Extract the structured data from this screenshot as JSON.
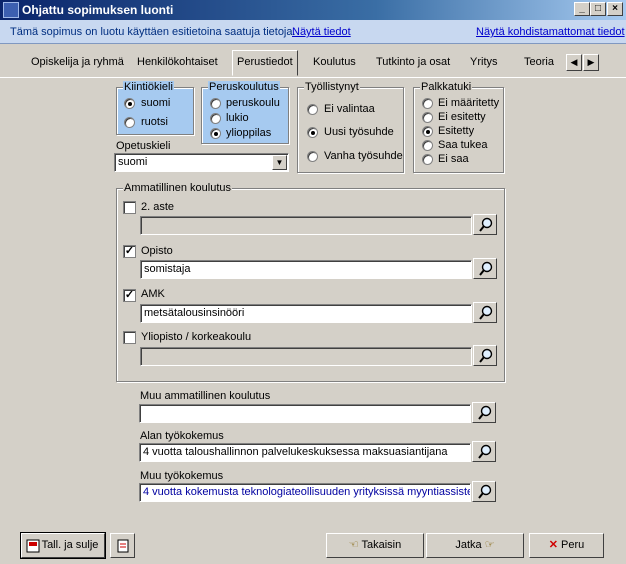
{
  "window": {
    "title": "Ohjattu sopimuksen luonti"
  },
  "info": {
    "message": "Tämä sopimus on luotu käyttäen esitietoina saatuja tietoja.",
    "show_info_link": "Näytä tiedot",
    "show_unassigned_link": "Näytä kohdistamattomat tiedot"
  },
  "tabs": [
    {
      "label": "Opiskelija ja ryhmä"
    },
    {
      "label": "Henkilökohtaiset"
    },
    {
      "label": "Perustiedot"
    },
    {
      "label": "Koulutus"
    },
    {
      "label": "Tutkinto ja osat"
    },
    {
      "label": "Yritys"
    },
    {
      "label": "Teoria"
    }
  ],
  "kiintiokieli": {
    "legend": "Kiintiökieli",
    "options": [
      "suomi",
      "ruotsi"
    ],
    "selected": "suomi"
  },
  "peruskoulutus": {
    "legend": "Peruskoulutus",
    "options": [
      "peruskoulu",
      "lukio",
      "ylioppilas"
    ],
    "selected": "ylioppilas"
  },
  "tyollistynyt": {
    "legend": "Työllistynyt",
    "options": [
      "Ei valintaa",
      "Uusi työsuhde",
      "Vanha työsuhde"
    ],
    "selected": "Uusi työsuhde"
  },
  "palkkatuki": {
    "legend": "Palkkatuki",
    "options": [
      "Ei määritetty",
      "Ei esitetty",
      "Esitetty",
      "Saa tukea",
      "Ei saa"
    ],
    "selected": "Esitetty"
  },
  "opetuskieli": {
    "label": "Opetuskieli",
    "value": "suomi"
  },
  "ammatillinen": {
    "legend": "Ammatillinen koulutus",
    "items": [
      {
        "label": "2. aste",
        "checked": false,
        "value": ""
      },
      {
        "label": "Opisto",
        "checked": true,
        "value": "somistaja"
      },
      {
        "label": "AMK",
        "checked": true,
        "value": "metsätalousinsinööri"
      },
      {
        "label": "Yliopisto / korkeakoulu",
        "checked": false,
        "value": ""
      }
    ]
  },
  "muu_ammatillinen": {
    "label": "Muu ammatillinen koulutus",
    "value": ""
  },
  "alan_tyokokemus": {
    "label": "Alan työkokemus",
    "value": "4 vuotta taloushallinnon palvelukeskuksessa maksuasiantijana"
  },
  "muu_tyokokemus": {
    "label": "Muu työkokemus",
    "value": "4 vuotta kokemusta teknologiateollisuuden yrityksissä myyntiassistentti"
  },
  "buttons": {
    "save_close": "Tall. ja sulje",
    "back": "Takaisin",
    "next": "Jatka",
    "cancel": "Peru"
  },
  "colors": {
    "titlebar": "#0a246a",
    "highlight": "#a6caf0",
    "link": "#0000cc"
  }
}
